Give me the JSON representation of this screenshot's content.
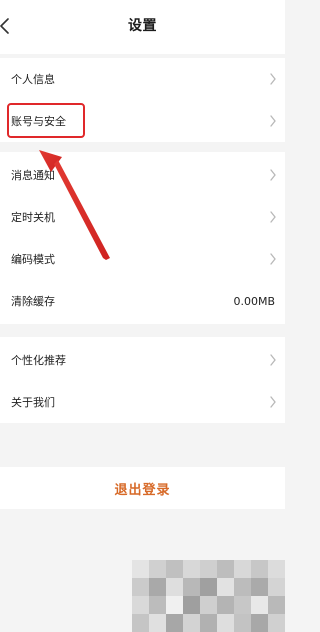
{
  "header": {
    "title": "设置"
  },
  "groups": {
    "account": [
      {
        "label": "个人信息"
      },
      {
        "label": "账号与安全"
      }
    ],
    "system": [
      {
        "label": "消息通知"
      },
      {
        "label": "定时关机"
      },
      {
        "label": "编码模式"
      },
      {
        "label": "清除缓存",
        "value": "0.00MB"
      }
    ],
    "other": [
      {
        "label": "个性化推荐"
      },
      {
        "label": "关于我们"
      }
    ]
  },
  "logout": {
    "label": "退出登录"
  },
  "colors": {
    "accent": "#d76927",
    "annotation": "#e0282a",
    "background": "#f4f4f4"
  },
  "icons": {
    "back": "chevron-left-icon",
    "row_arrow": "chevron-right-icon"
  }
}
